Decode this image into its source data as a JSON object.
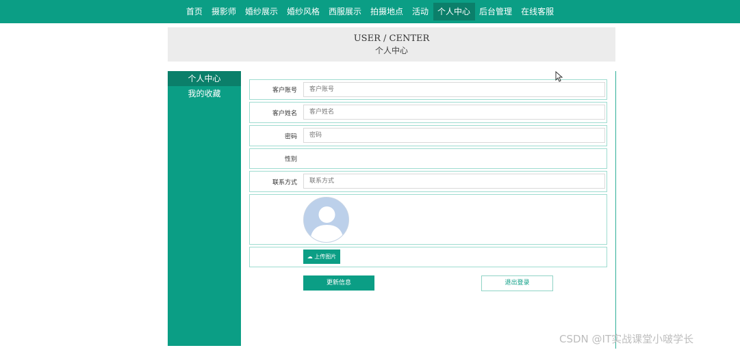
{
  "nav": {
    "items": [
      "首页",
      "摄影师",
      "婚纱展示",
      "婚纱风格",
      "西服展示",
      "拍摄地点",
      "活动",
      "个人中心",
      "后台管理",
      "在线客服"
    ],
    "active": "个人中心"
  },
  "banner": {
    "title_en": "USER / CENTER",
    "title_cn": "个人中心"
  },
  "sidebar": {
    "items": [
      "个人中心",
      "我的收藏"
    ]
  },
  "form": {
    "account_label": "客户账号",
    "account_placeholder": "客户账号",
    "name_label": "客户姓名",
    "name_placeholder": "客户姓名",
    "password_label": "密码",
    "password_placeholder": "密码",
    "gender_label": "性别",
    "contact_label": "联系方式",
    "contact_placeholder": "联系方式",
    "upload_label": "上传图片"
  },
  "buttons": {
    "update": "更新信息",
    "logout": "退出登录"
  },
  "watermark": "CSDN @IT实战课堂小啵学长",
  "colors": {
    "primary": "#0b9e85",
    "primary_dark": "#0b7f6a",
    "banner_bg": "#ececec",
    "border": "#9edcd0"
  },
  "icons": {
    "upload": "cloud-upload-icon",
    "avatar": "user-avatar-icon",
    "cursor": "mouse-pointer-icon"
  }
}
